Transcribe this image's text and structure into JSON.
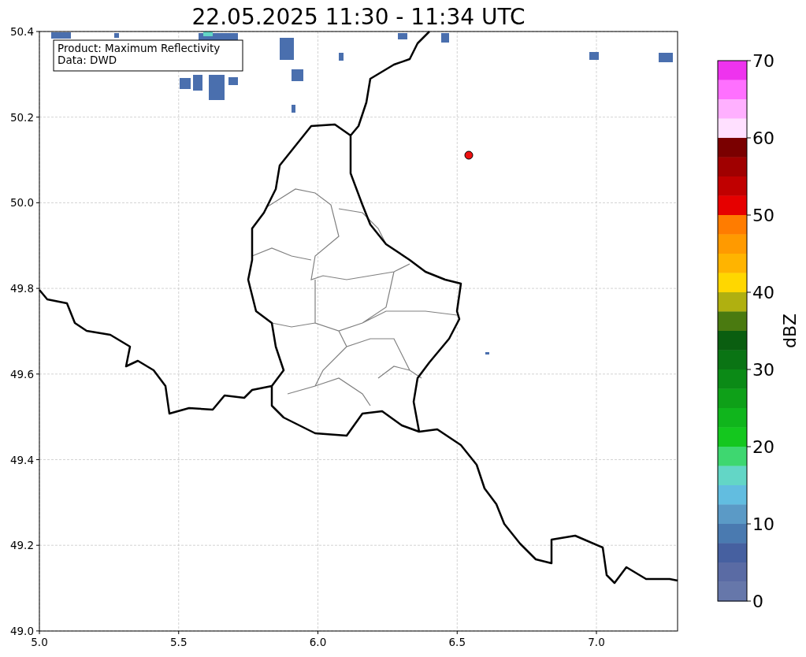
{
  "title": "22.05.2025 11:30 - 11:34 UTC",
  "legend": [
    "Product: Maximum Reflectivity",
    "Data: DWD"
  ],
  "x_ticks": [
    "5.0",
    "5.5",
    "6.0",
    "6.5",
    "7.0"
  ],
  "y_ticks": [
    "50.4",
    "50.2",
    "50.0",
    "49.8",
    "49.6",
    "49.4",
    "49.2",
    "49.0"
  ],
  "colorbar": {
    "label": "dBZ",
    "ticks": [
      "70",
      "60",
      "50",
      "40",
      "30",
      "20",
      "10",
      "0"
    ],
    "segments": [
      {
        "color": "#ee33ee"
      },
      {
        "color": "#ff70ff"
      },
      {
        "color": "#ffb0ff"
      },
      {
        "color": "#ffe0ff"
      },
      {
        "color": "#7a0000"
      },
      {
        "color": "#a00000"
      },
      {
        "color": "#c00000"
      },
      {
        "color": "#e60000"
      },
      {
        "color": "#ff7c00"
      },
      {
        "color": "#ff9a00"
      },
      {
        "color": "#ffb400"
      },
      {
        "color": "#ffd700"
      },
      {
        "color": "#b0b010"
      },
      {
        "color": "#4a7a10"
      },
      {
        "color": "#0a5e10"
      },
      {
        "color": "#0a7414"
      },
      {
        "color": "#0b8a16"
      },
      {
        "color": "#0ea018"
      },
      {
        "color": "#10b51c"
      },
      {
        "color": "#14c71e"
      },
      {
        "color": "#3ed770"
      },
      {
        "color": "#63d6c6"
      },
      {
        "color": "#62bde0"
      },
      {
        "color": "#5b9ac6"
      },
      {
        "color": "#4a7ab0"
      },
      {
        "color": "#4660a0"
      },
      {
        "color": "#5a6ba4"
      },
      {
        "color": "#6677aa"
      }
    ]
  }
}
